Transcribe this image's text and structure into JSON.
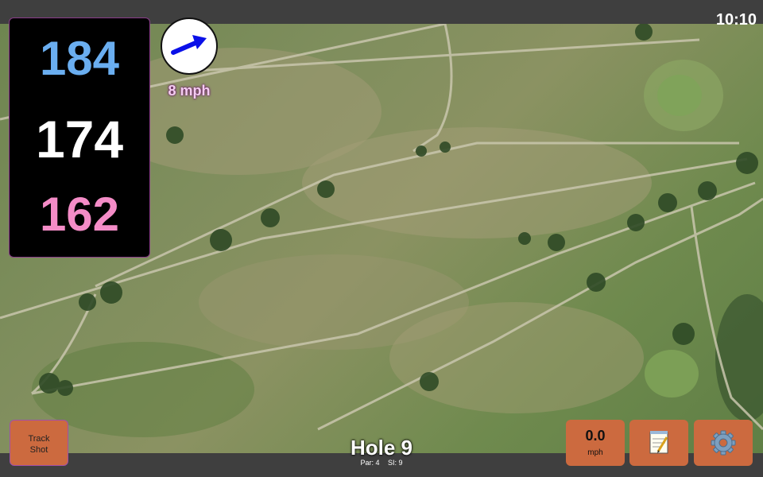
{
  "status": {
    "time": "10:10"
  },
  "distances": {
    "back": "184",
    "center": "174",
    "front": "162"
  },
  "wind": {
    "speed": "8 mph",
    "icon": "wind-arrow-icon"
  },
  "hole": {
    "title": "Hole 9",
    "par": "Par: 4",
    "stroke_index": "SI: 9"
  },
  "buttons": {
    "track_shot_line1": "Track",
    "track_shot_line2": "Shot",
    "speed_value": "0.0",
    "speed_unit": "mph",
    "notes_icon": "notepad-icon",
    "settings_icon": "gear-icon"
  },
  "colors": {
    "back": "#6aaef0",
    "center": "#ffffff",
    "front": "#f48cc7",
    "button": "#cc6a3f",
    "wind_arrow": "#0a10e8"
  }
}
